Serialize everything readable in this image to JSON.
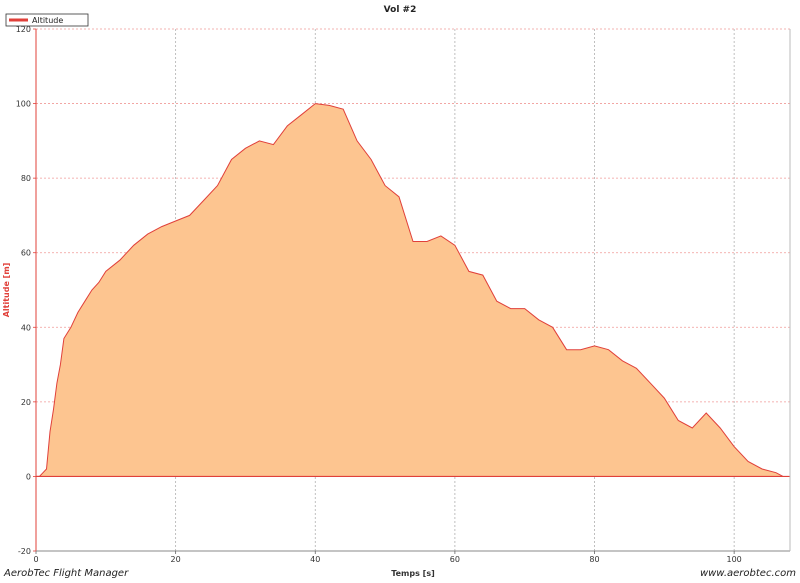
{
  "chart_data": {
    "type": "area",
    "title": "Vol #2",
    "xlabel": "Temps [s]",
    "ylabel": "Altitude [m]",
    "xlim": [
      0,
      108
    ],
    "ylim": [
      -20,
      120
    ],
    "xticks": [
      0,
      20,
      40,
      60,
      80,
      100
    ],
    "yticks": [
      -20,
      0,
      20,
      40,
      60,
      80,
      100,
      120
    ],
    "grid": true,
    "legend": "top-left",
    "series": [
      {
        "name": "Altitude",
        "color": "#e0403a",
        "fill": "#fdc590",
        "x": [
          0,
          0.5,
          1,
          1.5,
          2,
          2.5,
          3,
          3.5,
          4,
          5,
          6,
          7,
          8,
          9,
          10,
          12,
          14,
          16,
          18,
          20,
          22,
          24,
          26,
          28,
          30,
          32,
          34,
          36,
          38,
          40,
          42,
          44,
          46,
          48,
          50,
          52,
          54,
          56,
          58,
          60,
          62,
          64,
          66,
          68,
          70,
          72,
          74,
          76,
          78,
          80,
          82,
          84,
          86,
          88,
          90,
          91,
          92,
          94,
          96,
          98,
          100,
          102,
          104,
          106,
          107
        ],
        "values": [
          0,
          0,
          1,
          2,
          12,
          18,
          25,
          30,
          37,
          40,
          44,
          47,
          50,
          52,
          55,
          58,
          62,
          65,
          67,
          68.5,
          70,
          74,
          78,
          85,
          88,
          90,
          89,
          94,
          97,
          100,
          99.5,
          98.5,
          90,
          85,
          78,
          75,
          63,
          63,
          64.5,
          62,
          55,
          54,
          47,
          45,
          45,
          42,
          40,
          34,
          34,
          35,
          34,
          31,
          29,
          25,
          21,
          18,
          15,
          13,
          17,
          13,
          8,
          4,
          2,
          1,
          0
        ]
      }
    ]
  },
  "footer": {
    "left": "AerobTec Flight Manager",
    "right": "www.aerobtec.com"
  }
}
